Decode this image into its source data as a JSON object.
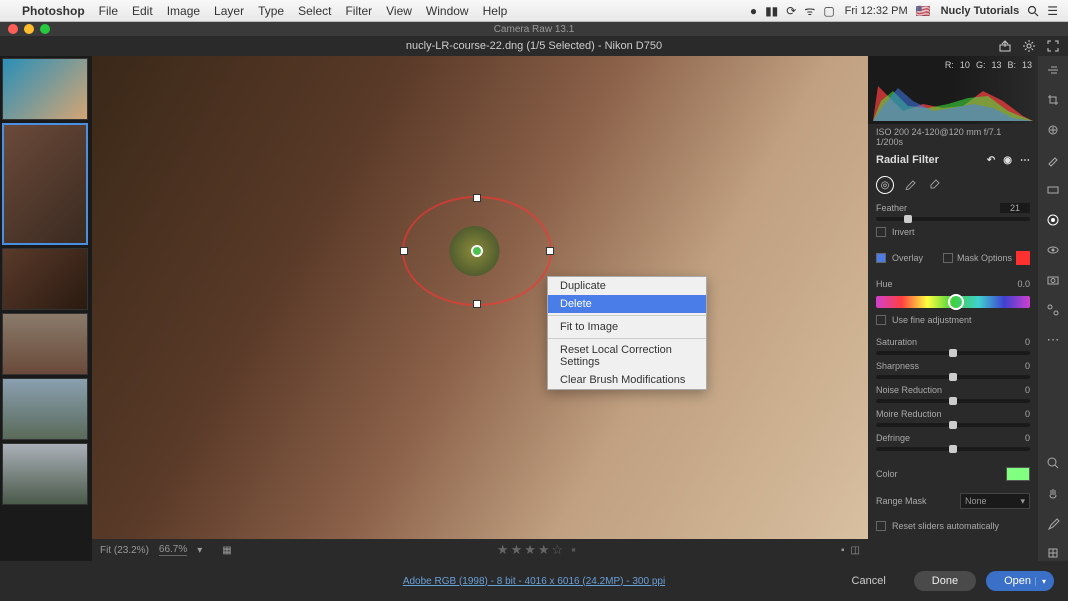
{
  "menubar": {
    "app_name": "Photoshop",
    "items": [
      "File",
      "Edit",
      "Image",
      "Layer",
      "Type",
      "Select",
      "Filter",
      "View",
      "Window",
      "Help"
    ],
    "clock": "Fri 12:32 PM",
    "user": "Nucly Tutorials"
  },
  "titlebar": {
    "title": "Camera Raw 13.1"
  },
  "doc_header": {
    "title": "nucly-LR-course-22.dng (1/5 Selected)  -  Nikon D750"
  },
  "context_menu": {
    "duplicate": "Duplicate",
    "delete": "Delete",
    "fit_to_image": "Fit to Image",
    "reset_local": "Reset Local Correction Settings",
    "clear_brush": "Clear Brush Modifications"
  },
  "canvas_bottom": {
    "fit": "Fit (23.2%)",
    "zoom": "66.7%"
  },
  "panel": {
    "rgb": {
      "r_label": "R:",
      "r_val": "10",
      "g_label": "G:",
      "g_val": "13",
      "b_label": "B:",
      "b_val": "13"
    },
    "exif": "ISO 200   24-120@120 mm   f/7.1   1/200s",
    "title": "Radial Filter",
    "feather_label": "Feather",
    "feather_val": "21",
    "invert_label": "Invert",
    "overlay_label": "Overlay",
    "mask_options_label": "Mask Options",
    "hue_label": "Hue",
    "hue_val": "0.0",
    "fine_adj_label": "Use fine adjustment",
    "saturation_label": "Saturation",
    "saturation_val": "0",
    "sharpness_label": "Sharpness",
    "sharpness_val": "0",
    "noise_label": "Noise Reduction",
    "noise_val": "0",
    "moire_label": "Moire Reduction",
    "moire_val": "0",
    "defringe_label": "Defringe",
    "defringe_val": "0",
    "color_label": "Color",
    "range_mask_label": "Range Mask",
    "range_mask_value": "None",
    "reset_sliders_label": "Reset sliders automatically"
  },
  "bottom": {
    "image_info": "Adobe RGB (1998) - 8 bit - 4016 x 6016 (24.2MP) - 300 ppi",
    "cancel": "Cancel",
    "done": "Done",
    "open": "Open"
  }
}
